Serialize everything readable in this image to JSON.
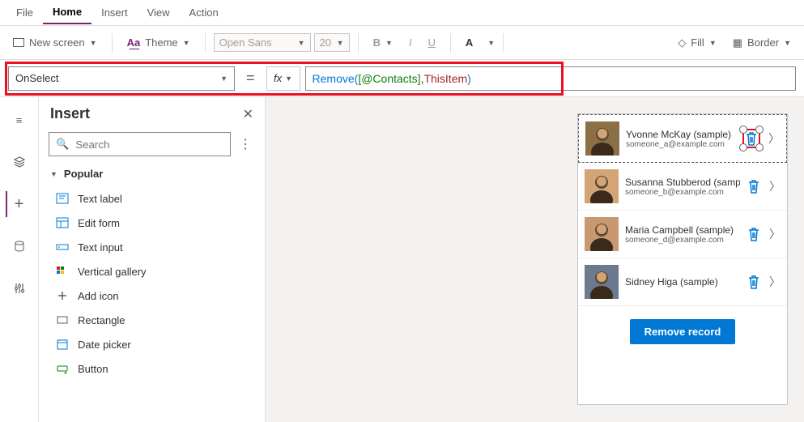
{
  "menubar": [
    "File",
    "Home",
    "Insert",
    "View",
    "Action"
  ],
  "menubar_active": 1,
  "ribbon": {
    "new_screen": "New screen",
    "theme": "Theme",
    "font": "Open Sans",
    "fontsize": "20",
    "fill": "Fill",
    "border": "Border"
  },
  "formula": {
    "property": "OnSelect",
    "tokens": [
      {
        "t": "fn",
        "v": "Remove"
      },
      {
        "t": "br",
        "v": "( "
      },
      {
        "t": "ds",
        "v": "[@Contacts]"
      },
      {
        "t": "plain",
        "v": ", "
      },
      {
        "t": "var",
        "v": "ThisItem"
      },
      {
        "t": "br",
        "v": " )"
      }
    ]
  },
  "insert": {
    "title": "Insert",
    "search_placeholder": "Search",
    "category": "Popular",
    "items": [
      {
        "icon": "text",
        "label": "Text label"
      },
      {
        "icon": "form",
        "label": "Edit form"
      },
      {
        "icon": "input",
        "label": "Text input"
      },
      {
        "icon": "gallery",
        "label": "Vertical gallery"
      },
      {
        "icon": "plus",
        "label": "Add icon"
      },
      {
        "icon": "rect",
        "label": "Rectangle"
      },
      {
        "icon": "date",
        "label": "Date picker"
      },
      {
        "icon": "button",
        "label": "Button"
      }
    ]
  },
  "contacts": [
    {
      "name": "Yvonne McKay (sample)",
      "email": "someone_a@example.com",
      "avatar_bg": "#8b6f47",
      "selected": true
    },
    {
      "name": "Susanna Stubberod (sample)",
      "email": "someone_b@example.com",
      "avatar_bg": "#d4a574"
    },
    {
      "name": "Maria Campbell (sample)",
      "email": "someone_d@example.com",
      "avatar_bg": "#c89870"
    },
    {
      "name": "Sidney Higa (sample)",
      "email": "",
      "avatar_bg": "#6b7a8f"
    }
  ],
  "button_label": "Remove record"
}
